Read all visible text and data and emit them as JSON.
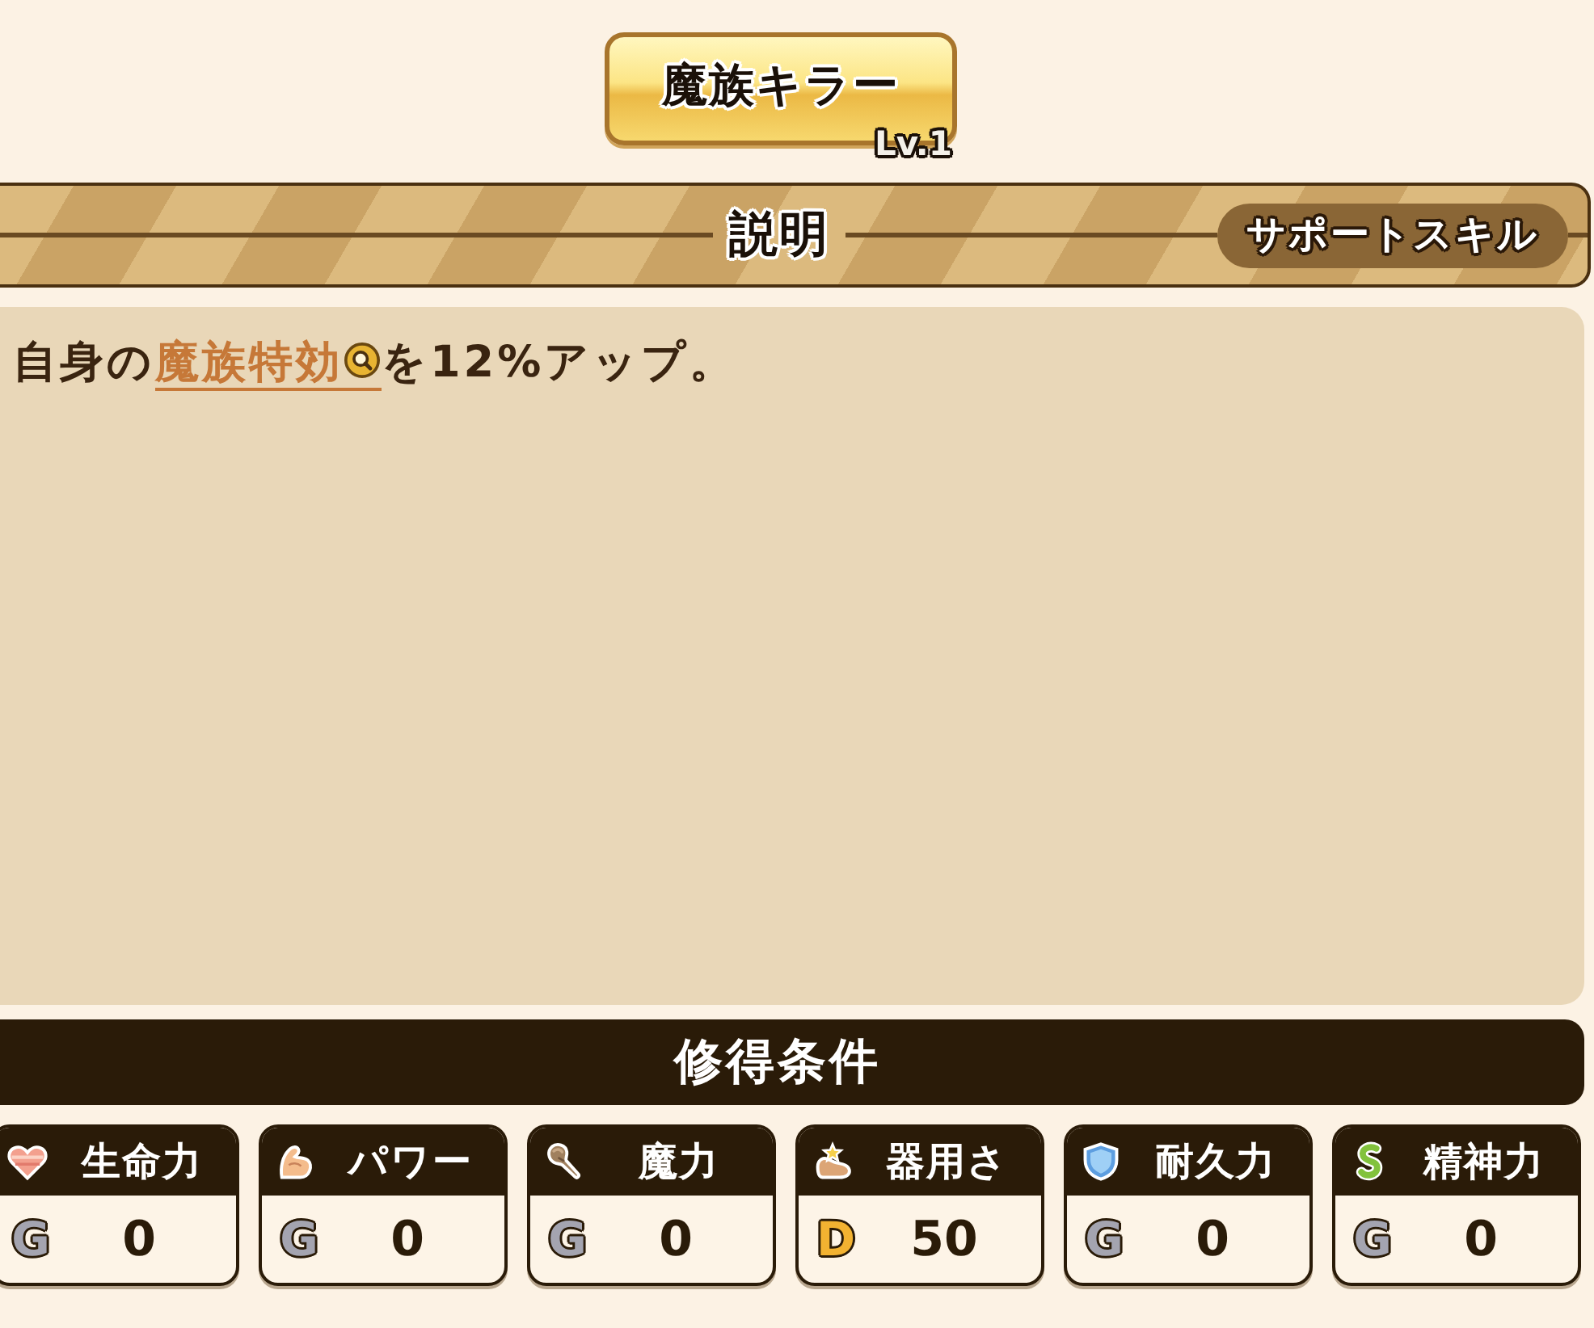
{
  "skill": {
    "name": "魔族キラー",
    "level": "Lv.1"
  },
  "header": {
    "title": "説明",
    "badge": "サポートスキル"
  },
  "description": {
    "parts": [
      {
        "kind": "text",
        "text": "自身の"
      },
      {
        "kind": "link",
        "text": "魔族特効"
      },
      {
        "kind": "text",
        "text": "を12%アップ。"
      }
    ]
  },
  "conditions": {
    "title": "修得条件",
    "stats": [
      {
        "kind": "vitality",
        "label": "生命力",
        "grade": {
          "text": "G",
          "color": "#a4a4b0"
        },
        "value": "0"
      },
      {
        "kind": "power",
        "label": "パワー",
        "grade": {
          "text": "G",
          "color": "#a4a4b0"
        },
        "value": "0"
      },
      {
        "kind": "magic",
        "label": "魔力",
        "grade": {
          "text": "G",
          "color": "#a4a4b0"
        },
        "value": "0"
      },
      {
        "kind": "dexterity",
        "label": "器用さ",
        "grade": {
          "text": "D",
          "color": "#f2b231"
        },
        "value": "50"
      },
      {
        "kind": "endurance",
        "label": "耐久力",
        "grade": {
          "text": "G",
          "color": "#a4a4b0"
        },
        "value": "0"
      },
      {
        "kind": "spirit",
        "label": "精神力",
        "grade": {
          "text": "G",
          "color": "#a4a4b0"
        },
        "value": "0"
      }
    ]
  }
}
